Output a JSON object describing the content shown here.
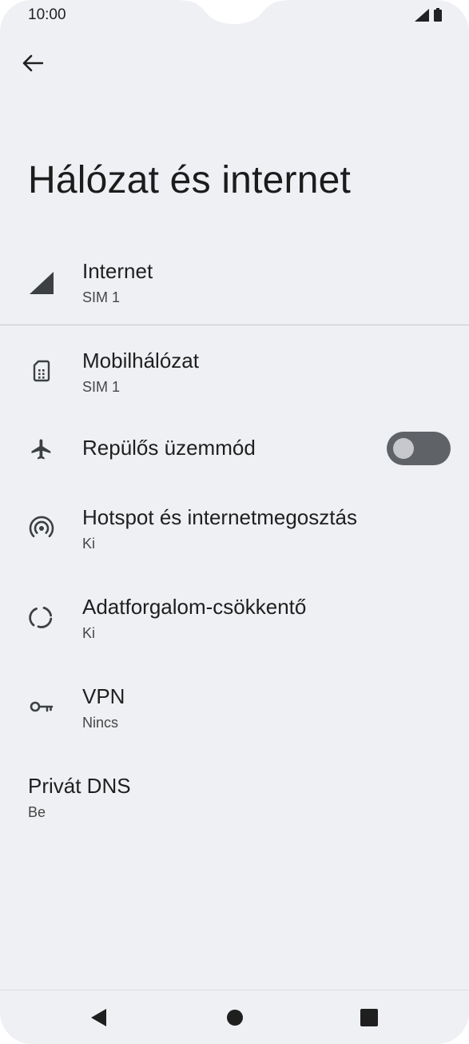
{
  "status_bar": {
    "time": "10:00",
    "icons": [
      "signal-icon",
      "battery-icon"
    ]
  },
  "header": {
    "title": "Hálózat és internet",
    "back_icon": "arrow-back-icon"
  },
  "items": [
    {
      "title": "Internet",
      "subtitle": "SIM 1",
      "icon": "cell-signal-icon"
    },
    {
      "title": "Mobilhálózat",
      "subtitle": "SIM 1",
      "icon": "sim-card-icon"
    },
    {
      "title": "Repülős üzemmód",
      "icon": "airplane-icon",
      "toggle": false
    },
    {
      "title": "Hotspot és internetmegosztás",
      "subtitle": "Ki",
      "icon": "hotspot-icon"
    },
    {
      "title": "Adatforgalom-csökkentő",
      "subtitle": "Ki",
      "icon": "data-saver-icon"
    },
    {
      "title": "VPN",
      "subtitle": "Nincs",
      "icon": "vpn-key-icon"
    },
    {
      "title": "Privát DNS",
      "subtitle": "Be"
    }
  ],
  "nav_bar": {
    "buttons": [
      "back-triangle-icon",
      "home-circle-icon",
      "recents-square-icon"
    ]
  },
  "colors": {
    "background": "#eff0f3",
    "toggle_track": "#5f6368",
    "toggle_knob": "#c6c8cc",
    "text": "#1f1f1f"
  }
}
